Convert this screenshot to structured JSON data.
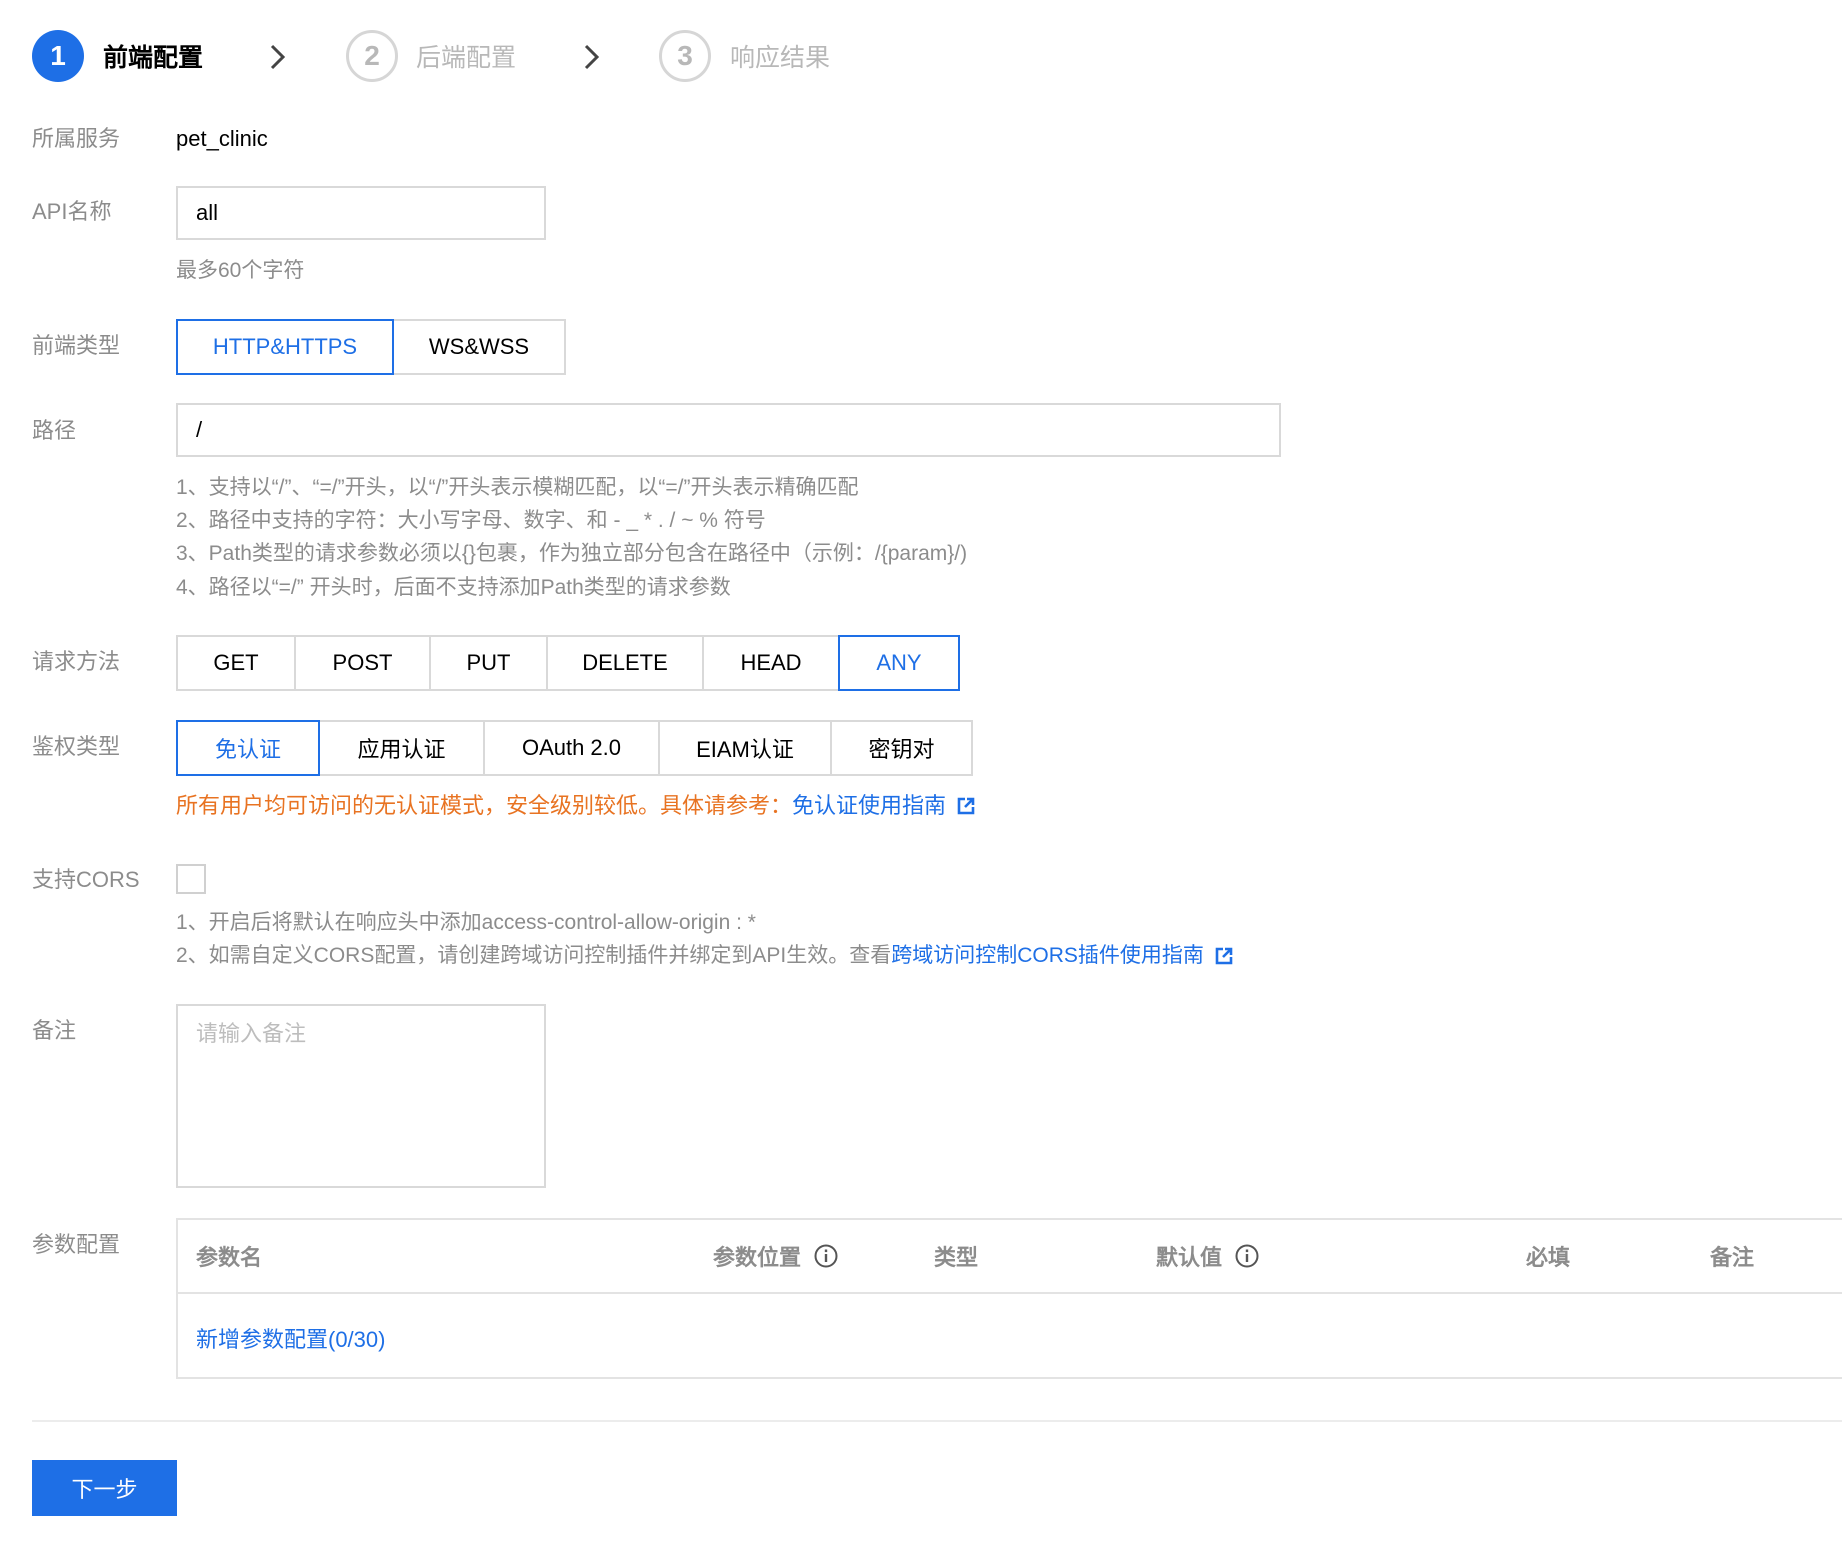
{
  "steps": [
    {
      "number": "1",
      "label": "前端配置",
      "state": "active"
    },
    {
      "number": "2",
      "label": "后端配置",
      "state": "inactive"
    },
    {
      "number": "3",
      "label": "响应结果",
      "state": "inactive"
    }
  ],
  "form": {
    "service": {
      "label": "所属服务",
      "value": "pet_clinic"
    },
    "api_name": {
      "label": "API名称",
      "value": "all",
      "hint": "最多60个字符"
    },
    "frontend_type": {
      "label": "前端类型",
      "options": [
        "HTTP&HTTPS",
        "WS&WSS"
      ],
      "selected": "HTTP&HTTPS"
    },
    "path": {
      "label": "路径",
      "value": "/",
      "hints": [
        "1、支持以“/”、“=/”开头，以“/”开头表示模糊匹配，以“=/”开头表示精确匹配",
        "2、路径中支持的字符：大小写字母、数字、和 - _ * . / ~ % 符号",
        "3、Path类型的请求参数必须以{}包裹，作为独立部分包含在路径中（示例：/{param}/)",
        "4、路径以“=/” 开头时，后面不支持添加Path类型的请求参数"
      ]
    },
    "method": {
      "label": "请求方法",
      "options": [
        "GET",
        "POST",
        "PUT",
        "DELETE",
        "HEAD",
        "ANY"
      ],
      "selected": "ANY"
    },
    "auth_type": {
      "label": "鉴权类型",
      "options": [
        "免认证",
        "应用认证",
        "OAuth 2.0",
        "EIAM认证",
        "密钥对"
      ],
      "selected": "免认证",
      "warning": "所有用户均可访问的无认证模式，安全级别较低。具体请参考：",
      "warning_link": "免认证使用指南"
    },
    "cors": {
      "label": "支持CORS",
      "checked": false,
      "hint1": "1、开启后将默认在响应头中添加access-control-allow-origin : *",
      "hint2_prefix": "2、如需自定义CORS配置，请创建跨域访问控制插件并绑定到API生效。查看",
      "hint2_link": "跨域访问控制CORS插件使用指南"
    },
    "remark": {
      "label": "备注",
      "placeholder": "请输入备注"
    },
    "params": {
      "label": "参数配置",
      "columns": [
        "参数名",
        "参数位置",
        "类型",
        "默认值",
        "必填",
        "备注"
      ],
      "add_link": "新增参数配置(0/30)"
    }
  },
  "footer": {
    "next_button": "下一步"
  },
  "colors": {
    "primary": "#1e6fe6",
    "warning": "#e87322",
    "muted": "#8c8c8c",
    "border": "#d9d9d9"
  },
  "icons": [
    "chevron-right-icon",
    "external-link-icon",
    "info-icon"
  ]
}
